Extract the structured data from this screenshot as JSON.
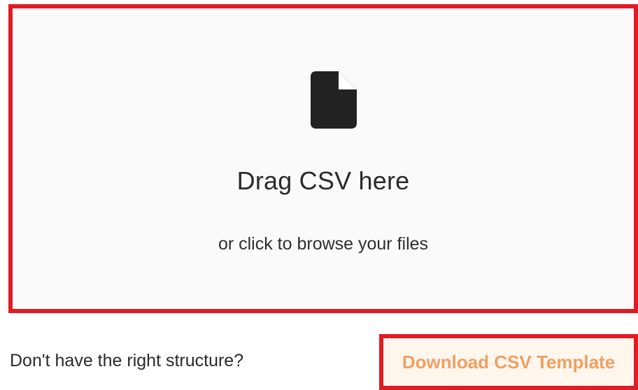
{
  "dropzone": {
    "icon": "file-icon",
    "title": "Drag CSV here",
    "subtitle": "or click to browse your files"
  },
  "footer": {
    "prompt_text": "Don't have the right structure?",
    "download_button_label": "Download CSV Template"
  },
  "colors": {
    "highlight_border": "#e01b24",
    "button_text": "#f0a061",
    "button_background": "#fff6ee",
    "dropzone_background": "#fafafa",
    "icon_fill": "#222222"
  }
}
